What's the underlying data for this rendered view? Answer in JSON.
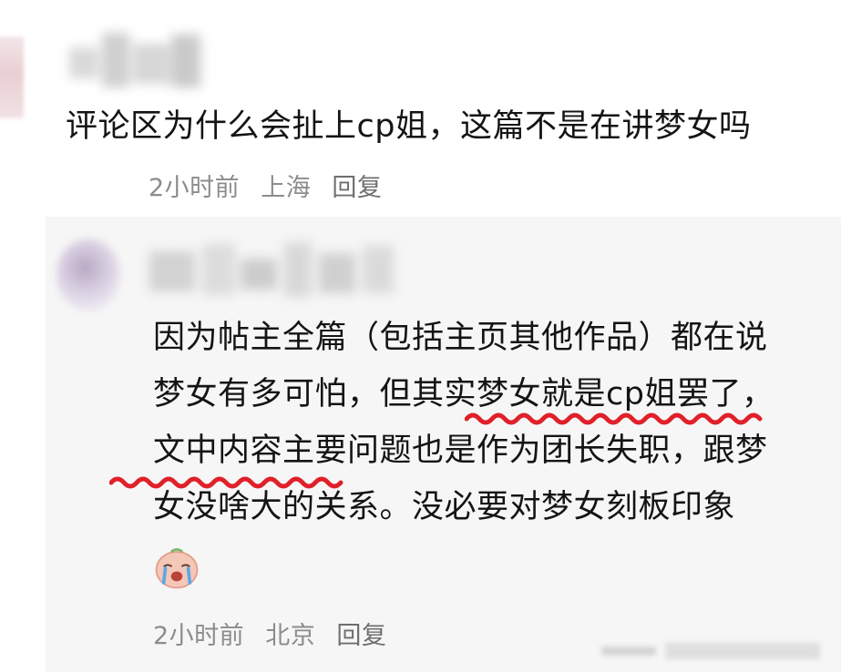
{
  "comment": {
    "text": "评论区为什么会扯上cp姐，这篇不是在讲梦女吗",
    "time": "2小时前",
    "location": "上海",
    "reply_label": "回复"
  },
  "reply": {
    "text": "因为帖主全篇（包括主页其他作品）都在说梦女有多可怕，但其实梦女就是cp姐罢了，文中内容主要问题也是作为团长失职，跟梦女没啥大的关系。没必要对梦女刻板印象",
    "emoji": "crying-face-emoji",
    "time": "2小时前",
    "location": "北京",
    "reply_label": "回复",
    "highlight_color": "#e0202a"
  }
}
